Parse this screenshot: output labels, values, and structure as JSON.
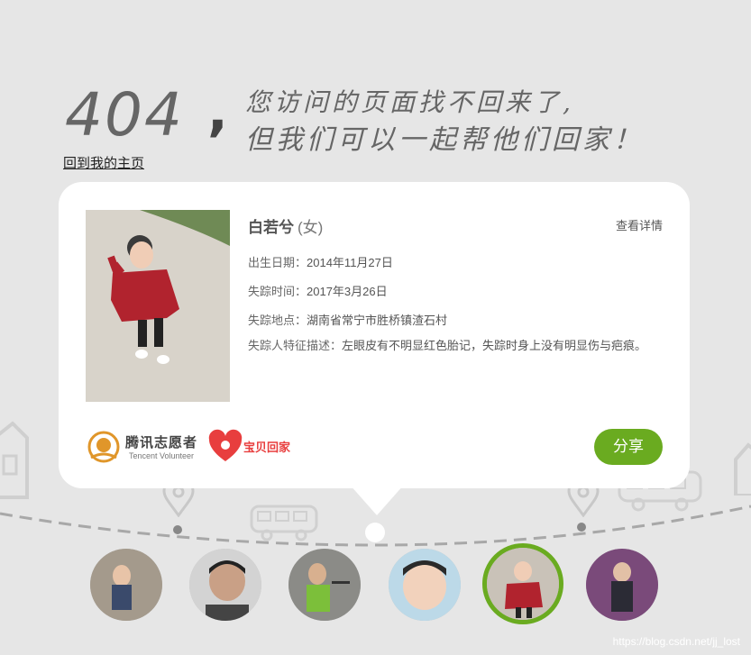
{
  "header": {
    "code": "404",
    "comma": ",",
    "line1": "您访问的页面找不回来了,",
    "line2": "但我们可以一起帮他们回家！",
    "home_link": "回到我的主页"
  },
  "card": {
    "name": "白若兮",
    "gender": "(女)",
    "detail_link": "查看详情",
    "birth_label": "出生日期：",
    "birth_value": "2014年11月27日",
    "missing_time_label": "失踪时间：",
    "missing_time_value": "2017年3月26日",
    "missing_place_label": "失踪地点：",
    "missing_place_value": "湖南省常宁市胜桥镇渣石村",
    "features_label": "失踪人特征描述：",
    "features_value": "左眼皮有不明显红色胎记，失踪时身上没有明显伤与疤痕。",
    "share_button": "分享",
    "logo_tencent_main": "腾讯志愿者",
    "logo_tencent_sub": "Tencent Volunteer",
    "logo_baobei": "宝贝回家"
  },
  "avatars": [
    {
      "name": "child-1",
      "selected": false
    },
    {
      "name": "child-2",
      "selected": false
    },
    {
      "name": "child-3",
      "selected": false
    },
    {
      "name": "child-4",
      "selected": false
    },
    {
      "name": "child-5",
      "selected": true
    },
    {
      "name": "child-6",
      "selected": false
    }
  ],
  "watermark": "https://blog.csdn.net/jj_lost",
  "colors": {
    "background": "#e6e6e6",
    "accent_green": "#6aab20",
    "text": "#555555",
    "card": "#ffffff"
  }
}
